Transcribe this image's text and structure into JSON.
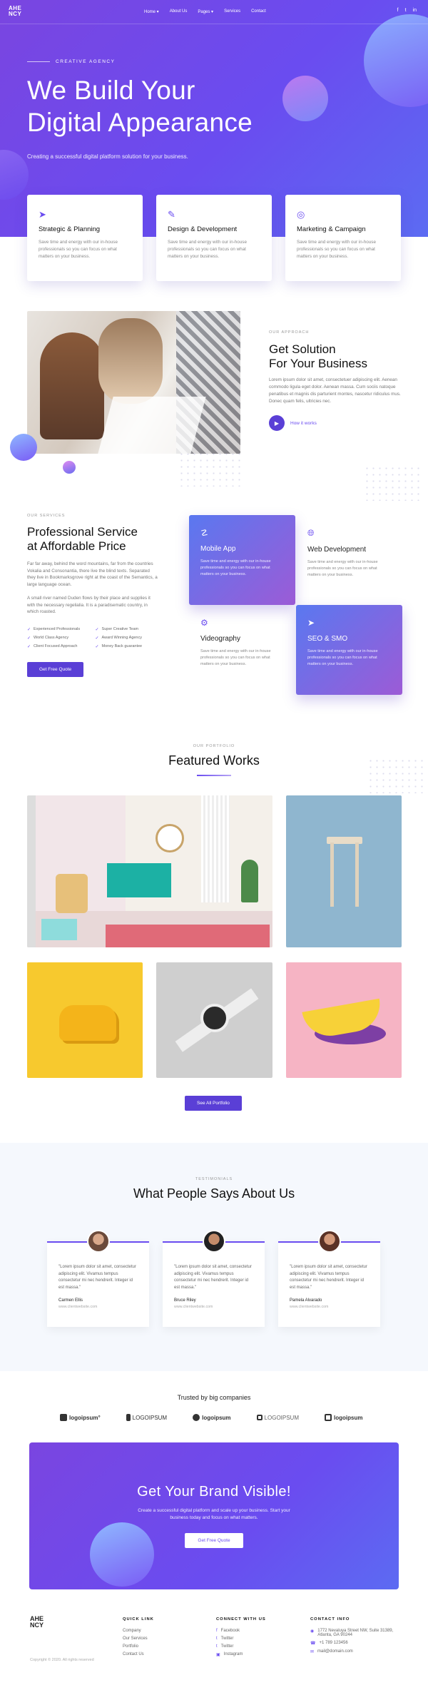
{
  "header": {
    "logo_top": "AHE",
    "logo_bottom": "NCY",
    "nav": [
      "Home ▾",
      "About Us",
      "Pages ▾",
      "Services",
      "Contact"
    ],
    "socials": [
      "f",
      "t",
      "in"
    ]
  },
  "hero": {
    "eyebrow": "CREATIVE AGENCY",
    "title_line1": "We Build Your",
    "title_line2": "Digital Appearance",
    "subtitle": "Creating a successful digital platform solution for your business."
  },
  "features": [
    {
      "icon": "paper-plane-icon",
      "title": "Strategic & Planning",
      "text": "Save time and energy with our in-house professionals so you can focus on what matters on your business."
    },
    {
      "icon": "design-icon",
      "title": "Design & Development",
      "text": "Save time and energy with our in-house professionals so you can focus on what matters on your business."
    },
    {
      "icon": "target-icon",
      "title": "Marketing & Campaign",
      "text": "Save time and energy with our in-house professionals so you can focus on what matters on your business."
    }
  ],
  "approach": {
    "eyebrow": "OUR APPROACH",
    "title_line1": "Get Solution",
    "title_line2": "For Your Business",
    "text": "Lorem ipsum dolor sit amet, consectetuer adipiscing elit. Aenean commodo ligula eget dolor. Aenean massa. Cum sociis natoque penatibus et magnis dis parturient montes, nascetur ridiculus mus. Donec quam felis, ultricies nec.",
    "how_label": "How it works"
  },
  "services": {
    "eyebrow": "OUR SERVICES",
    "title_line1": "Professional Service",
    "title_line2": "at Affordable Price",
    "para1": "Far far away, behind the word mountains, far from the countries Vokalia and Consonantia, there live the blind texts. Separated they live in Bookmarksgrove right at the coast of the Semantics, a large language ocean.",
    "para2": "A small river named Duden flows by their place and supplies it with the necessary regelialia. It is a paradisematic country, in which roasted.",
    "checks": [
      "Experienced Professionals",
      "Super Creative Team",
      "World Class Agency",
      "Award Winning Agency",
      "Client Focused Approach",
      "Money Back guarantee"
    ],
    "button": "Get Free Quote",
    "cards": [
      {
        "title": "Mobile App",
        "text": "Save time and energy with our in-house professionals so you can focus on what matters on your business."
      },
      {
        "title": "Web Development",
        "text": "Save time and energy with our in-house professionals so you can focus on what matters on your business."
      },
      {
        "title": "Videography",
        "text": "Save time and energy with our in-house professionals so you can focus on what matters on your business."
      },
      {
        "title": "SEO & SMO",
        "text": "Save time and energy with our in-house professionals so you can focus on what matters on your business."
      }
    ]
  },
  "portfolio": {
    "eyebrow": "OUR PORTFOLIO",
    "title": "Featured Works",
    "button": "See All Portfolio"
  },
  "testimonials": {
    "eyebrow": "TESTIMONIALS",
    "title": "What People Says About Us",
    "items": [
      {
        "quote": "\"Lorem ipsum dolor sit amet, consectetur adipiscing elit. Vivamus tempus consectetur mi nec hendrerit. Integer id est massa.\"",
        "name": "Carmen Ellis",
        "site": "www.clientwebsite.com"
      },
      {
        "quote": "\"Lorem ipsum dolor sit amet, consectetur adipiscing elit. Vivamus tempus consectetur mi nec hendrerit. Integer id est massa.\"",
        "name": "Bruce Riley",
        "site": "www.clientwebsite.com"
      },
      {
        "quote": "\"Lorem ipsum dolor sit amet, consectetur adipiscing elit. Vivamus tempus consectetur mi nec hendrerit. Integer id est massa.\"",
        "name": "Pamela Alvarado",
        "site": "www.clientwebsite.com"
      }
    ]
  },
  "brands": {
    "title": "Trusted by big companies",
    "logos": [
      "logoipsum°",
      "LOGOIPSUM",
      "logoipsum",
      "LOGOIPSUM",
      "logoipsum"
    ]
  },
  "cta": {
    "title": "Get Your Brand Visible!",
    "text": "Create a successful digital platform and scale up your business. Start your business today and focus on what matters.",
    "button": "Get Free Quote"
  },
  "footer": {
    "logo_top": "AHE",
    "logo_bottom": "NCY",
    "copyright": "Copyright © 2020. All rights reserved",
    "quick_title": "QUICK LINK",
    "quick": [
      "Company",
      "Our Services",
      "Portfolio",
      "Contact Us"
    ],
    "connect_title": "CONNECT WITH US",
    "connect": [
      "Facebook",
      "Twitter",
      "Twitter",
      "Instagram"
    ],
    "contact_title": "CONTACT INFO",
    "address1": "1772 Nevaluya Street NW, Suite 31389,",
    "address2": "Atlanta, GA 90244",
    "phone": "+1 789 123456",
    "email": "mail@domain.com"
  }
}
